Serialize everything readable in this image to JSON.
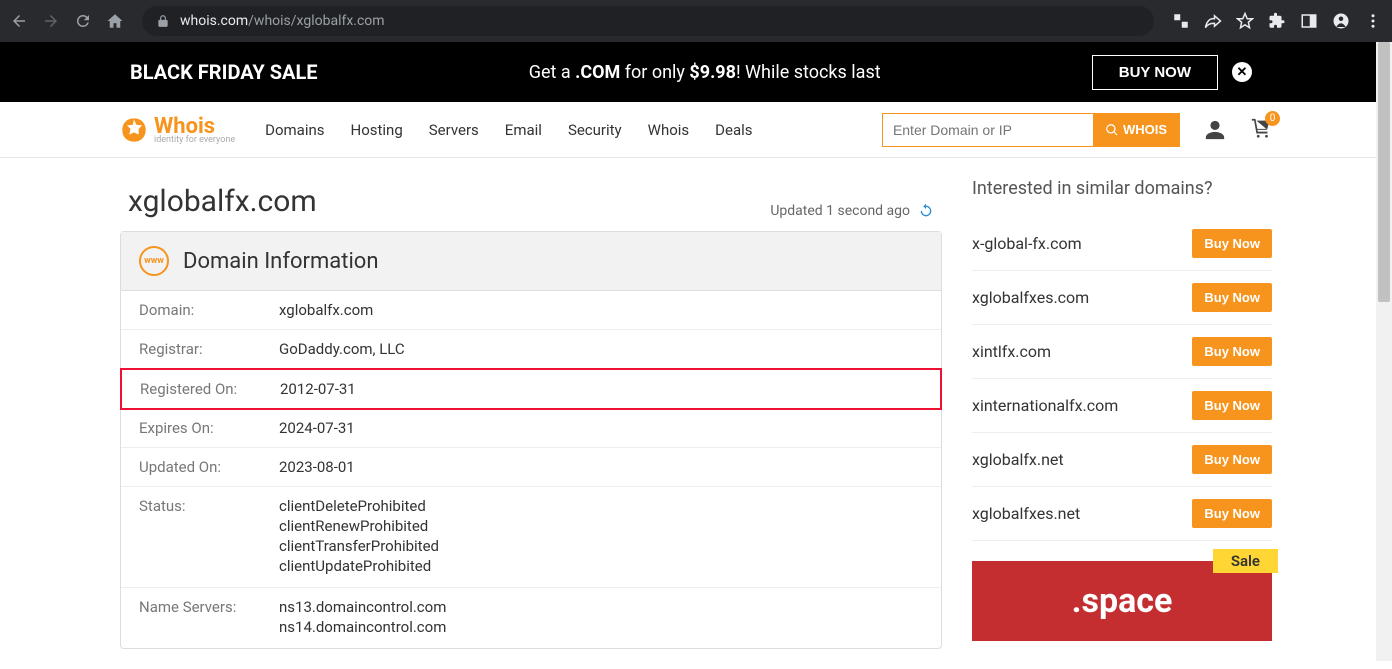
{
  "browser": {
    "url_pre": "whois.com",
    "url_path": "/whois/xglobalfx.com"
  },
  "banner": {
    "left": "BLACK FRIDAY SALE",
    "mid_pre": "Get a ",
    "mid_bold1": ".COM",
    "mid_mid": " for only ",
    "mid_bold2": "$9.98",
    "mid_post": "! While stocks last",
    "cta": "BUY NOW"
  },
  "nav": {
    "items": [
      "Domains",
      "Hosting",
      "Servers",
      "Email",
      "Security",
      "Whois",
      "Deals"
    ],
    "search_placeholder": "Enter Domain or IP",
    "search_btn": "WHOIS",
    "cart_count": "0",
    "logo_text": "Whois",
    "logo_sub": "identity for everyone"
  },
  "page": {
    "title": "xglobalfx.com",
    "updated": "Updated 1 second ago",
    "card_title": "Domain Information",
    "rows": {
      "domain_l": "Domain:",
      "domain_v": "xglobalfx.com",
      "registrar_l": "Registrar:",
      "registrar_v": "GoDaddy.com, LLC",
      "registered_l": "Registered On:",
      "registered_v": "2012-07-31",
      "expires_l": "Expires On:",
      "expires_v": "2024-07-31",
      "updated_l": "Updated On:",
      "updated_v": "2023-08-01",
      "status_l": "Status:",
      "status_v": [
        "clientDeleteProhibited",
        "clientRenewProhibited",
        "clientTransferProhibited",
        "clientUpdateProhibited"
      ],
      "ns_l": "Name Servers:",
      "ns_v": [
        "ns13.domaincontrol.com",
        "ns14.domaincontrol.com"
      ]
    }
  },
  "sidebar": {
    "title": "Interested in similar domains?",
    "buy": "Buy Now",
    "items": [
      "x-global-fx.com",
      "xglobalfxes.com",
      "xintlfx.com",
      "xinternationalfx.com",
      "xglobalfx.net",
      "xglobalfxes.net"
    ],
    "promo": ".space",
    "sale": "Sale"
  }
}
